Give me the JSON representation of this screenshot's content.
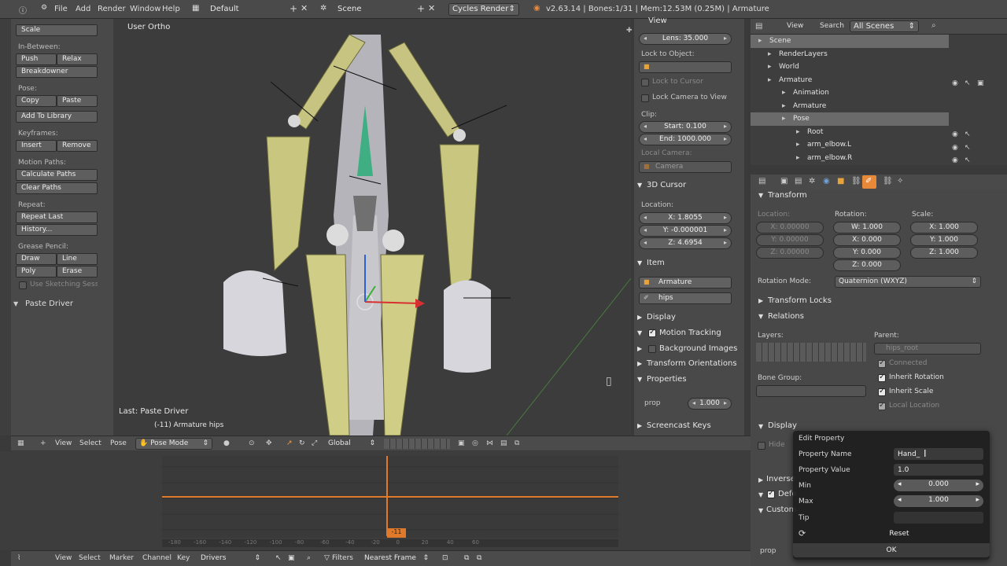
{
  "topbar": {
    "menus": [
      "File",
      "Add",
      "Render",
      "Window",
      "Help"
    ],
    "layout": "Default",
    "scene": "Scene",
    "engine": "Cycles Render",
    "stats": "v2.63.14 | Bones:1/31 | Mem:12.53M (0.25M) | Armature"
  },
  "tools": {
    "top_label": "Scale",
    "inbetween": "In-Between:",
    "push": "Push",
    "relax": "Relax",
    "breakdowner": "Breakdowner",
    "pose": "Pose:",
    "copy": "Copy",
    "paste": "Paste",
    "add_to_library": "Add To Library",
    "keyframes": "Keyframes:",
    "insert": "Insert",
    "remove": "Remove",
    "motion_paths": "Motion Paths:",
    "calculate_paths": "Calculate Paths",
    "clear_paths": "Clear Paths",
    "repeat": "Repeat:",
    "repeat_last": "Repeat Last",
    "history": "History...",
    "grease_pencil": "Grease Pencil:",
    "draw": "Draw",
    "line": "Line",
    "poly": "Poly",
    "erase": "Erase",
    "use_sketching": "Use Sketching Sessio",
    "paste_driver": "Paste Driver"
  },
  "viewport": {
    "view_label": "User Ortho",
    "last_op": "Last: Paste Driver",
    "frame_info": "(-11) Armature hips"
  },
  "npanel": {
    "view": "View",
    "lens": "Lens: 35.000",
    "lock_to_object": "Lock to Object:",
    "lock_to_cursor": "Lock to Cursor",
    "lock_camera": "Lock Camera to View",
    "clip": "Clip:",
    "clip_start": "Start: 0.100",
    "clip_end": "End: 1000.000",
    "local_camera": "Local Camera:",
    "camera": "Camera",
    "cursor_header": "3D Cursor",
    "location": "Location:",
    "cx": "X: 1.8055",
    "cy": "Y: -0.000001",
    "cz": "Z: 4.6954",
    "item_header": "Item",
    "item_armature": "Armature",
    "item_bone": "hips",
    "display": "Display",
    "motion_tracking": "Motion Tracking",
    "background_images": "Background Images",
    "transform_orientations": "Transform Orientations",
    "properties": "Properties",
    "prop_name": "prop",
    "prop_value": "1.000",
    "screencast": "Screencast Keys"
  },
  "outliner": {
    "view": "View",
    "search": "Search",
    "scope": "All Scenes",
    "rows": [
      {
        "label": "Scene",
        "sel": true,
        "indent": 10
      },
      {
        "label": "RenderLayers",
        "sel": false,
        "indent": 22
      },
      {
        "label": "World",
        "sel": false,
        "indent": 22
      },
      {
        "label": "Armature",
        "sel": false,
        "indent": 22
      },
      {
        "label": "Animation",
        "sel": false,
        "indent": 40
      },
      {
        "label": "Armature",
        "sel": false,
        "indent": 40
      },
      {
        "label": "Pose",
        "sel": true,
        "indent": 40
      },
      {
        "label": "Root",
        "sel": false,
        "indent": 58
      },
      {
        "label": "arm_elbow.L",
        "sel": false,
        "indent": 58
      },
      {
        "label": "arm_elbow.R",
        "sel": false,
        "indent": 58
      }
    ]
  },
  "props": {
    "transform": "Transform",
    "location": "Location:",
    "rotation": "Rotation:",
    "scale": "Scale:",
    "loc": [
      "X: 0.00000",
      "Y: 0.00000",
      "Z: 0.00000"
    ],
    "rot": [
      "W: 1.000",
      "X: 0.000",
      "Y: 0.000",
      "Z: 0.000"
    ],
    "scl": [
      "X: 1.000",
      "Y: 1.000",
      "Z: 1.000"
    ],
    "rotation_mode": "Rotation Mode:",
    "rotation_mode_value": "Quaternion (WXYZ)",
    "transform_locks": "Transform Locks",
    "relations": "Relations",
    "layers": "Layers:",
    "parent": "Parent:",
    "parent_value": "hips_root",
    "connected": "Connected",
    "bone_group": "Bone Group:",
    "inherit_rotation": "Inherit Rotation",
    "inherit_scale": "Inherit Scale",
    "local_location": "Local Location",
    "display": "Display",
    "hide": "Hide",
    "inverse": "Inverse",
    "deform": "Defo",
    "custom": "Custom",
    "prop_label": "prop"
  },
  "viewport_header": {
    "view": "View",
    "select": "Select",
    "pose": "Pose",
    "mode": "Pose Mode",
    "orientation": "Global"
  },
  "timeline": {
    "current_frame": "-11",
    "ticks": [
      "-180",
      "-160",
      "-140",
      "-120",
      "-100",
      "-80",
      "-60",
      "-40",
      "-20",
      "0",
      "20",
      "40",
      "60"
    ]
  },
  "drivers_header": {
    "view": "View",
    "select": "Select",
    "marker": "Marker",
    "channel": "Channel",
    "key": "Key",
    "mode": "Drivers",
    "filters": "Filters",
    "snap": "Nearest Frame"
  },
  "popup": {
    "title": "Edit Property",
    "name_label": "Property Name",
    "name_value": "Hand_",
    "value_label": "Property Value",
    "value_value": "1.0",
    "min_label": "Min",
    "min_value": "0.000",
    "max_label": "Max",
    "max_value": "1.000",
    "tip_label": "Tip",
    "reset": "Reset",
    "ok": "OK"
  }
}
